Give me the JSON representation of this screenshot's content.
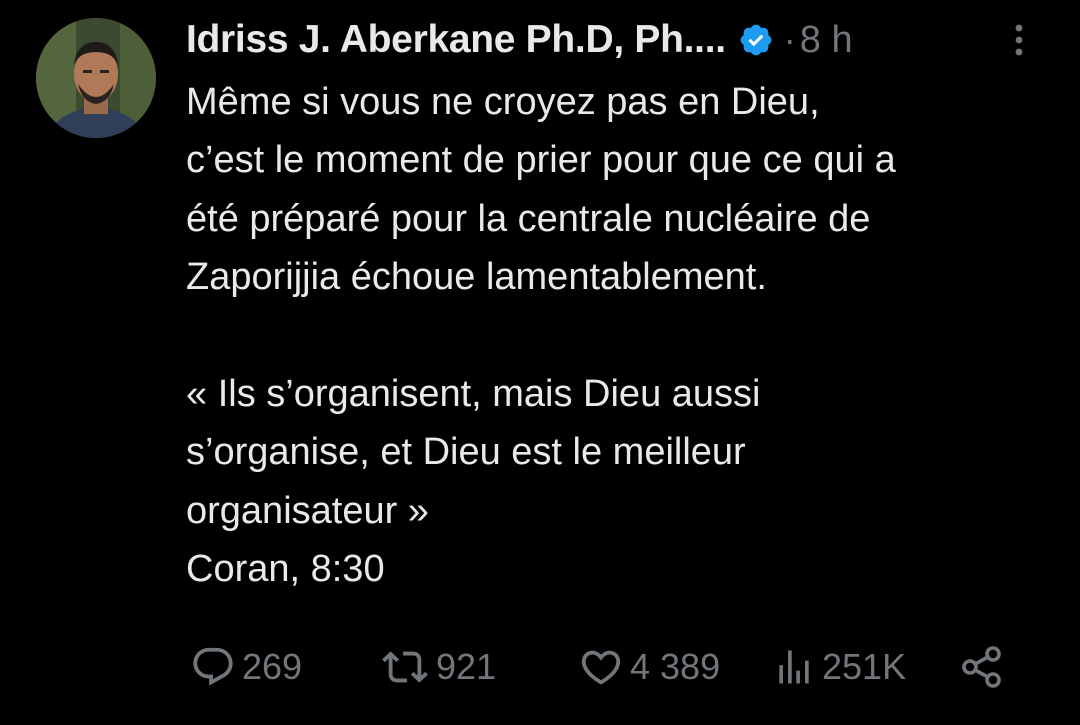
{
  "author": {
    "display_name": "Idriss J. Aberkane Ph.D, Ph....",
    "verified": true,
    "separator": "·",
    "time": "8 h"
  },
  "tweet": {
    "lines": [
      "Même si vous ne croyez pas en Dieu,",
      "c’est le moment de prier pour que ce qui a",
      "été préparé pour la centrale nucléaire de",
      "Zaporijjia échoue lamentablement.",
      "",
      "« Ils s’organisent, mais Dieu aussi",
      "s’organise, et Dieu est le meilleur",
      "organisateur »",
      "Coran, 8:30"
    ]
  },
  "actions": {
    "replies": "269",
    "retweets": "921",
    "likes": "4 389",
    "views": "251K"
  },
  "icons": {
    "avatar": "avatar-photo",
    "verified": "verified-badge-icon",
    "more": "more-vertical-icon",
    "reply": "reply-icon",
    "retweet": "retweet-icon",
    "like": "heart-icon",
    "views": "views-chart-icon",
    "share": "share-icon"
  },
  "colors": {
    "background": "#000000",
    "text": "#e7e9ea",
    "muted": "#71767b",
    "verified": "#1d9bf0"
  }
}
